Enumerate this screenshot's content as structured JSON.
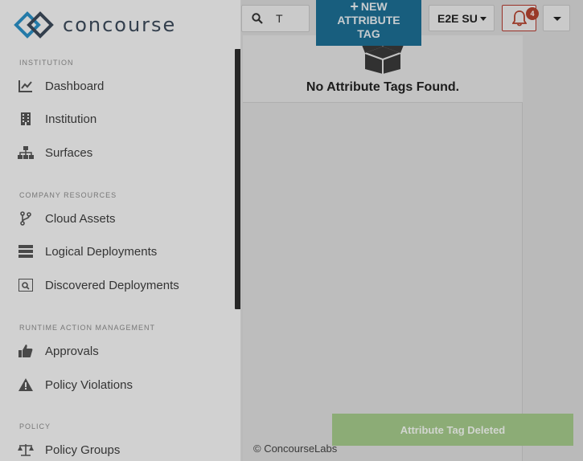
{
  "brand": {
    "name": "concourse"
  },
  "sidebar": {
    "sections": [
      {
        "label": "INSTITUTION"
      },
      {
        "label": "COMPANY RESOURCES"
      },
      {
        "label": "RUNTIME ACTION MANAGEMENT"
      },
      {
        "label": "POLICY"
      }
    ],
    "items": [
      {
        "label": "Dashboard",
        "icon": "chart-line-icon"
      },
      {
        "label": "Institution",
        "icon": "building-icon"
      },
      {
        "label": "Surfaces",
        "icon": "sitemap-icon"
      },
      {
        "label": "Cloud Assets",
        "icon": "code-branch-icon"
      },
      {
        "label": "Logical Deployments",
        "icon": "server-stack-icon"
      },
      {
        "label": "Discovered Deployments",
        "icon": "search-server-icon"
      },
      {
        "label": "Approvals",
        "icon": "thumbs-up-icon"
      },
      {
        "label": "Policy Violations",
        "icon": "warning-icon"
      },
      {
        "label": "Policy Groups",
        "icon": "balance-scale-icon"
      }
    ]
  },
  "header": {
    "search": {
      "value": "T",
      "placeholder": ""
    },
    "new_button": {
      "line1": "NEW",
      "line2": "ATTRIBUTE",
      "line3": "TAG"
    },
    "environment": {
      "selected": "E2E SU"
    },
    "notifications": {
      "count": "4"
    }
  },
  "main": {
    "empty_message": "No Attribute Tags Found."
  },
  "footer": {
    "text": "© ConcourseLabs"
  },
  "toast": {
    "message": "Attribute Tag Deleted"
  },
  "colors": {
    "primary": "#1c6e93",
    "danger": "#b3432f",
    "success_toast": "#a3c98a",
    "logo_blue": "#2a8fc4",
    "logo_dark": "#3c4a5a"
  }
}
